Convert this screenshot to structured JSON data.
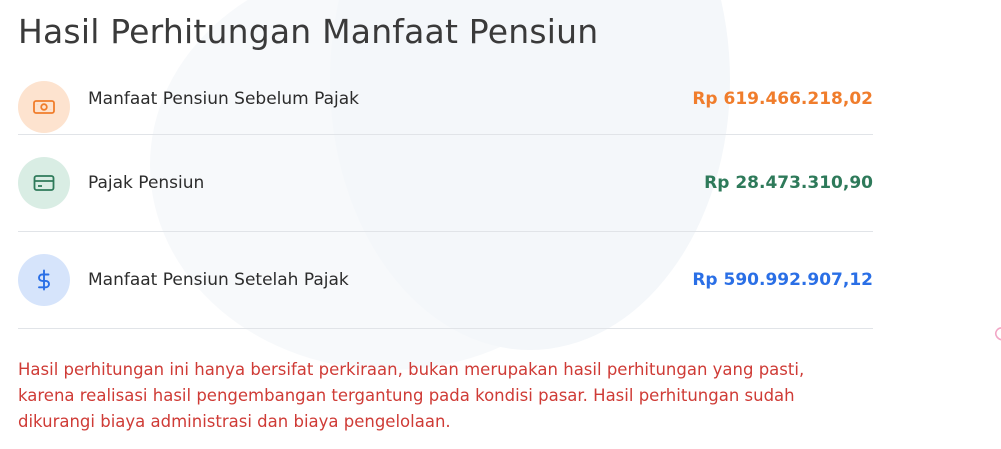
{
  "title": "Hasil Perhitungan Manfaat Pensiun",
  "rows": [
    {
      "icon": "money-icon",
      "label": "Manfaat Pensiun Sebelum Pajak",
      "value": "Rp 619.466.218,02",
      "color": "#f07d2c"
    },
    {
      "icon": "credit-card-icon",
      "label": "Pajak Pensiun",
      "value": "Rp 28.473.310,90",
      "color": "#2e7a5a"
    },
    {
      "icon": "dollar-icon",
      "label": "Manfaat Pensiun Setelah Pajak",
      "value": "Rp 590.992.907,12",
      "color": "#2a6fe6"
    }
  ],
  "note": "Hasil perhitungan ini hanya bersifat perkiraan, bukan merupakan hasil perhitungan yang pasti, karena realisasi hasil pengembangan tergantung pada kondisi pasar. Hasil perhitungan sudah dikurangi biaya administrasi dan biaya pengelolaan.",
  "colors": {
    "title": "#3a3a3a",
    "note": "#cf3b36",
    "divider": "#e1e4e8"
  }
}
